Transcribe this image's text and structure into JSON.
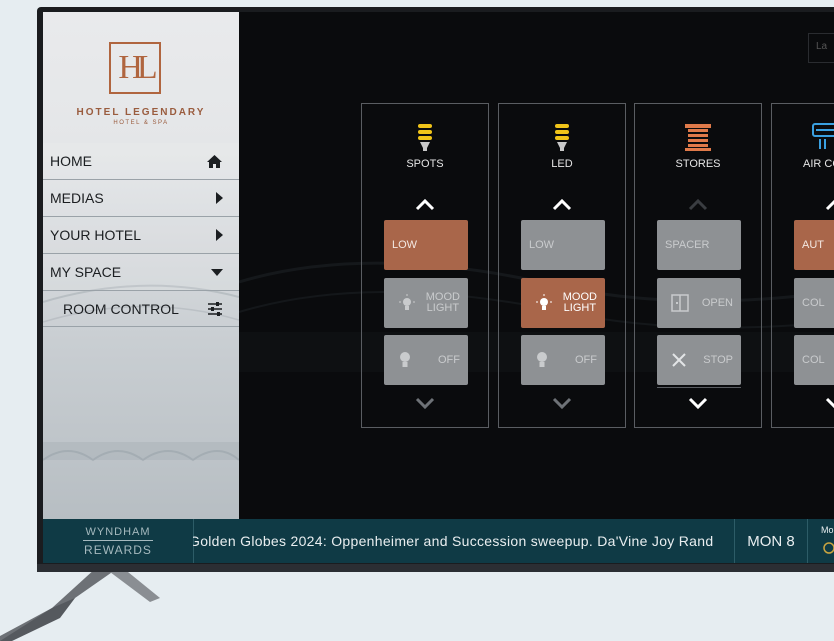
{
  "hotel": {
    "logo_initials": "HL",
    "name": "HOTEL LEGENDARY",
    "subtitle": "HOTEL & SPA"
  },
  "menu": {
    "items": [
      {
        "label": "HOME",
        "icon": "home-icon"
      },
      {
        "label": "MEDIAS",
        "icon": "chevron-right-icon"
      },
      {
        "label": "YOUR HOTEL",
        "icon": "chevron-right-icon"
      },
      {
        "label": "MY SPACE",
        "icon": "chevron-down-icon"
      }
    ],
    "subitems": [
      {
        "label": "ROOM CONTROL",
        "icon": "sliders-icon"
      }
    ]
  },
  "top_right": {
    "lang_label": "La"
  },
  "panels": [
    {
      "label": "SPOTS",
      "icon": "light-bulb-icon",
      "icon_color": "#f0c419",
      "buttons": [
        {
          "label": "LOW",
          "state": "active"
        },
        {
          "label": "MOOD\nLIGHT",
          "line1": "MOOD",
          "line2": "LIGHT",
          "state": "inactive",
          "icon": "mood-light-icon"
        },
        {
          "label": "OFF",
          "state": "inactive",
          "icon": "bulb-off-icon"
        }
      ]
    },
    {
      "label": "LED",
      "icon": "light-bulb-icon",
      "icon_color": "#f0c419",
      "buttons": [
        {
          "label": "LOW",
          "state": "inactive"
        },
        {
          "line1": "MOOD",
          "line2": "LIGHT",
          "state": "active",
          "icon": "mood-light-icon"
        },
        {
          "label": "OFF",
          "state": "inactive",
          "icon": "bulb-off-icon"
        }
      ]
    },
    {
      "label": "STORES",
      "icon": "window-blind-icon",
      "icon_color": "#e07a4a",
      "buttons": [
        {
          "label": "SPACER",
          "state": "inactive"
        },
        {
          "label": "OPEN",
          "state": "inactive",
          "icon": "door-open-icon"
        },
        {
          "label": "STOP",
          "state": "inactive",
          "icon": "stop-x-icon"
        }
      ]
    },
    {
      "label": "AIR CO",
      "icon": "air-conditioner-icon",
      "icon_color": "#3aa0e0",
      "buttons": [
        {
          "label": "AUT",
          "state": "active"
        },
        {
          "label": "COL",
          "state": "inactive"
        },
        {
          "label": "COL",
          "state": "inactive"
        }
      ]
    }
  ],
  "ticker": {
    "brand_line1": "WYNDHAM",
    "brand_line2": "REWARDS",
    "news": "Golden Globes 2024: Oppenheimer and Succession sweepup. Da'Vine Joy Rand",
    "date": "MON 8",
    "weather_label": "Mo"
  },
  "colors": {
    "accent_copper": "#a9664a",
    "button_grey": "#8e9194",
    "ticker_bg": "#0f3a45",
    "logo_brown": "#b0653f"
  }
}
